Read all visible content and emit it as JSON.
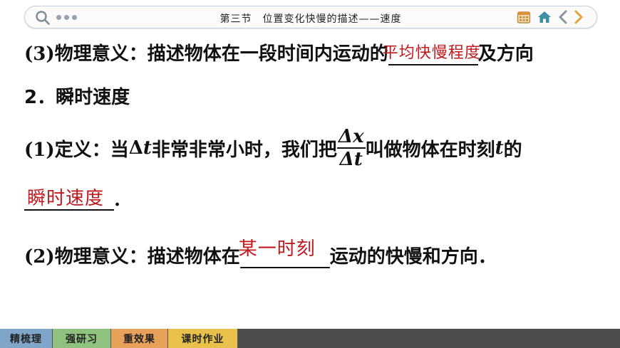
{
  "header": {
    "title": "第三节　位置变化快慢的描述——速度",
    "icons": [
      "search-icon",
      "more-dots-icon",
      "calendar-icon",
      "home-icon",
      "prev-arrow-icon",
      "next-arrow-icon"
    ]
  },
  "content": {
    "line1": {
      "prefix": "(3)物理意义：描述物体在一段时间内运动的",
      "answer": "平均快慢程度",
      "suffix": "及方向"
    },
    "line2": {
      "text": "2．瞬时速度"
    },
    "line3": {
      "prefix": "(1)定义：当 ",
      "delta_t": "Δ",
      "t_var": "t",
      "mid": " 非常非常小时，我们把",
      "frac_num": "Δx",
      "frac_den": "Δt",
      "after_frac": "叫做物体在时刻 ",
      "t2": "t",
      "suffix": " 的"
    },
    "line4": {
      "answer": "瞬时速度",
      "suffix": "."
    },
    "line5": {
      "prefix": "(2)物理意义：描述物体在",
      "answer": "某一时刻",
      "suffix": "运动的快慢和方向．"
    }
  },
  "nav": {
    "tabs": [
      {
        "label": "精梳理",
        "color": "#7fa6c8"
      },
      {
        "label": "强研习",
        "color": "#8fc27e"
      },
      {
        "label": "重效果",
        "color": "#e8a15a"
      },
      {
        "label": "课时作业",
        "color": "#e7c14a"
      }
    ]
  },
  "colors": {
    "answer": "#c0191e",
    "bar_bg": "#4c4c4c"
  }
}
